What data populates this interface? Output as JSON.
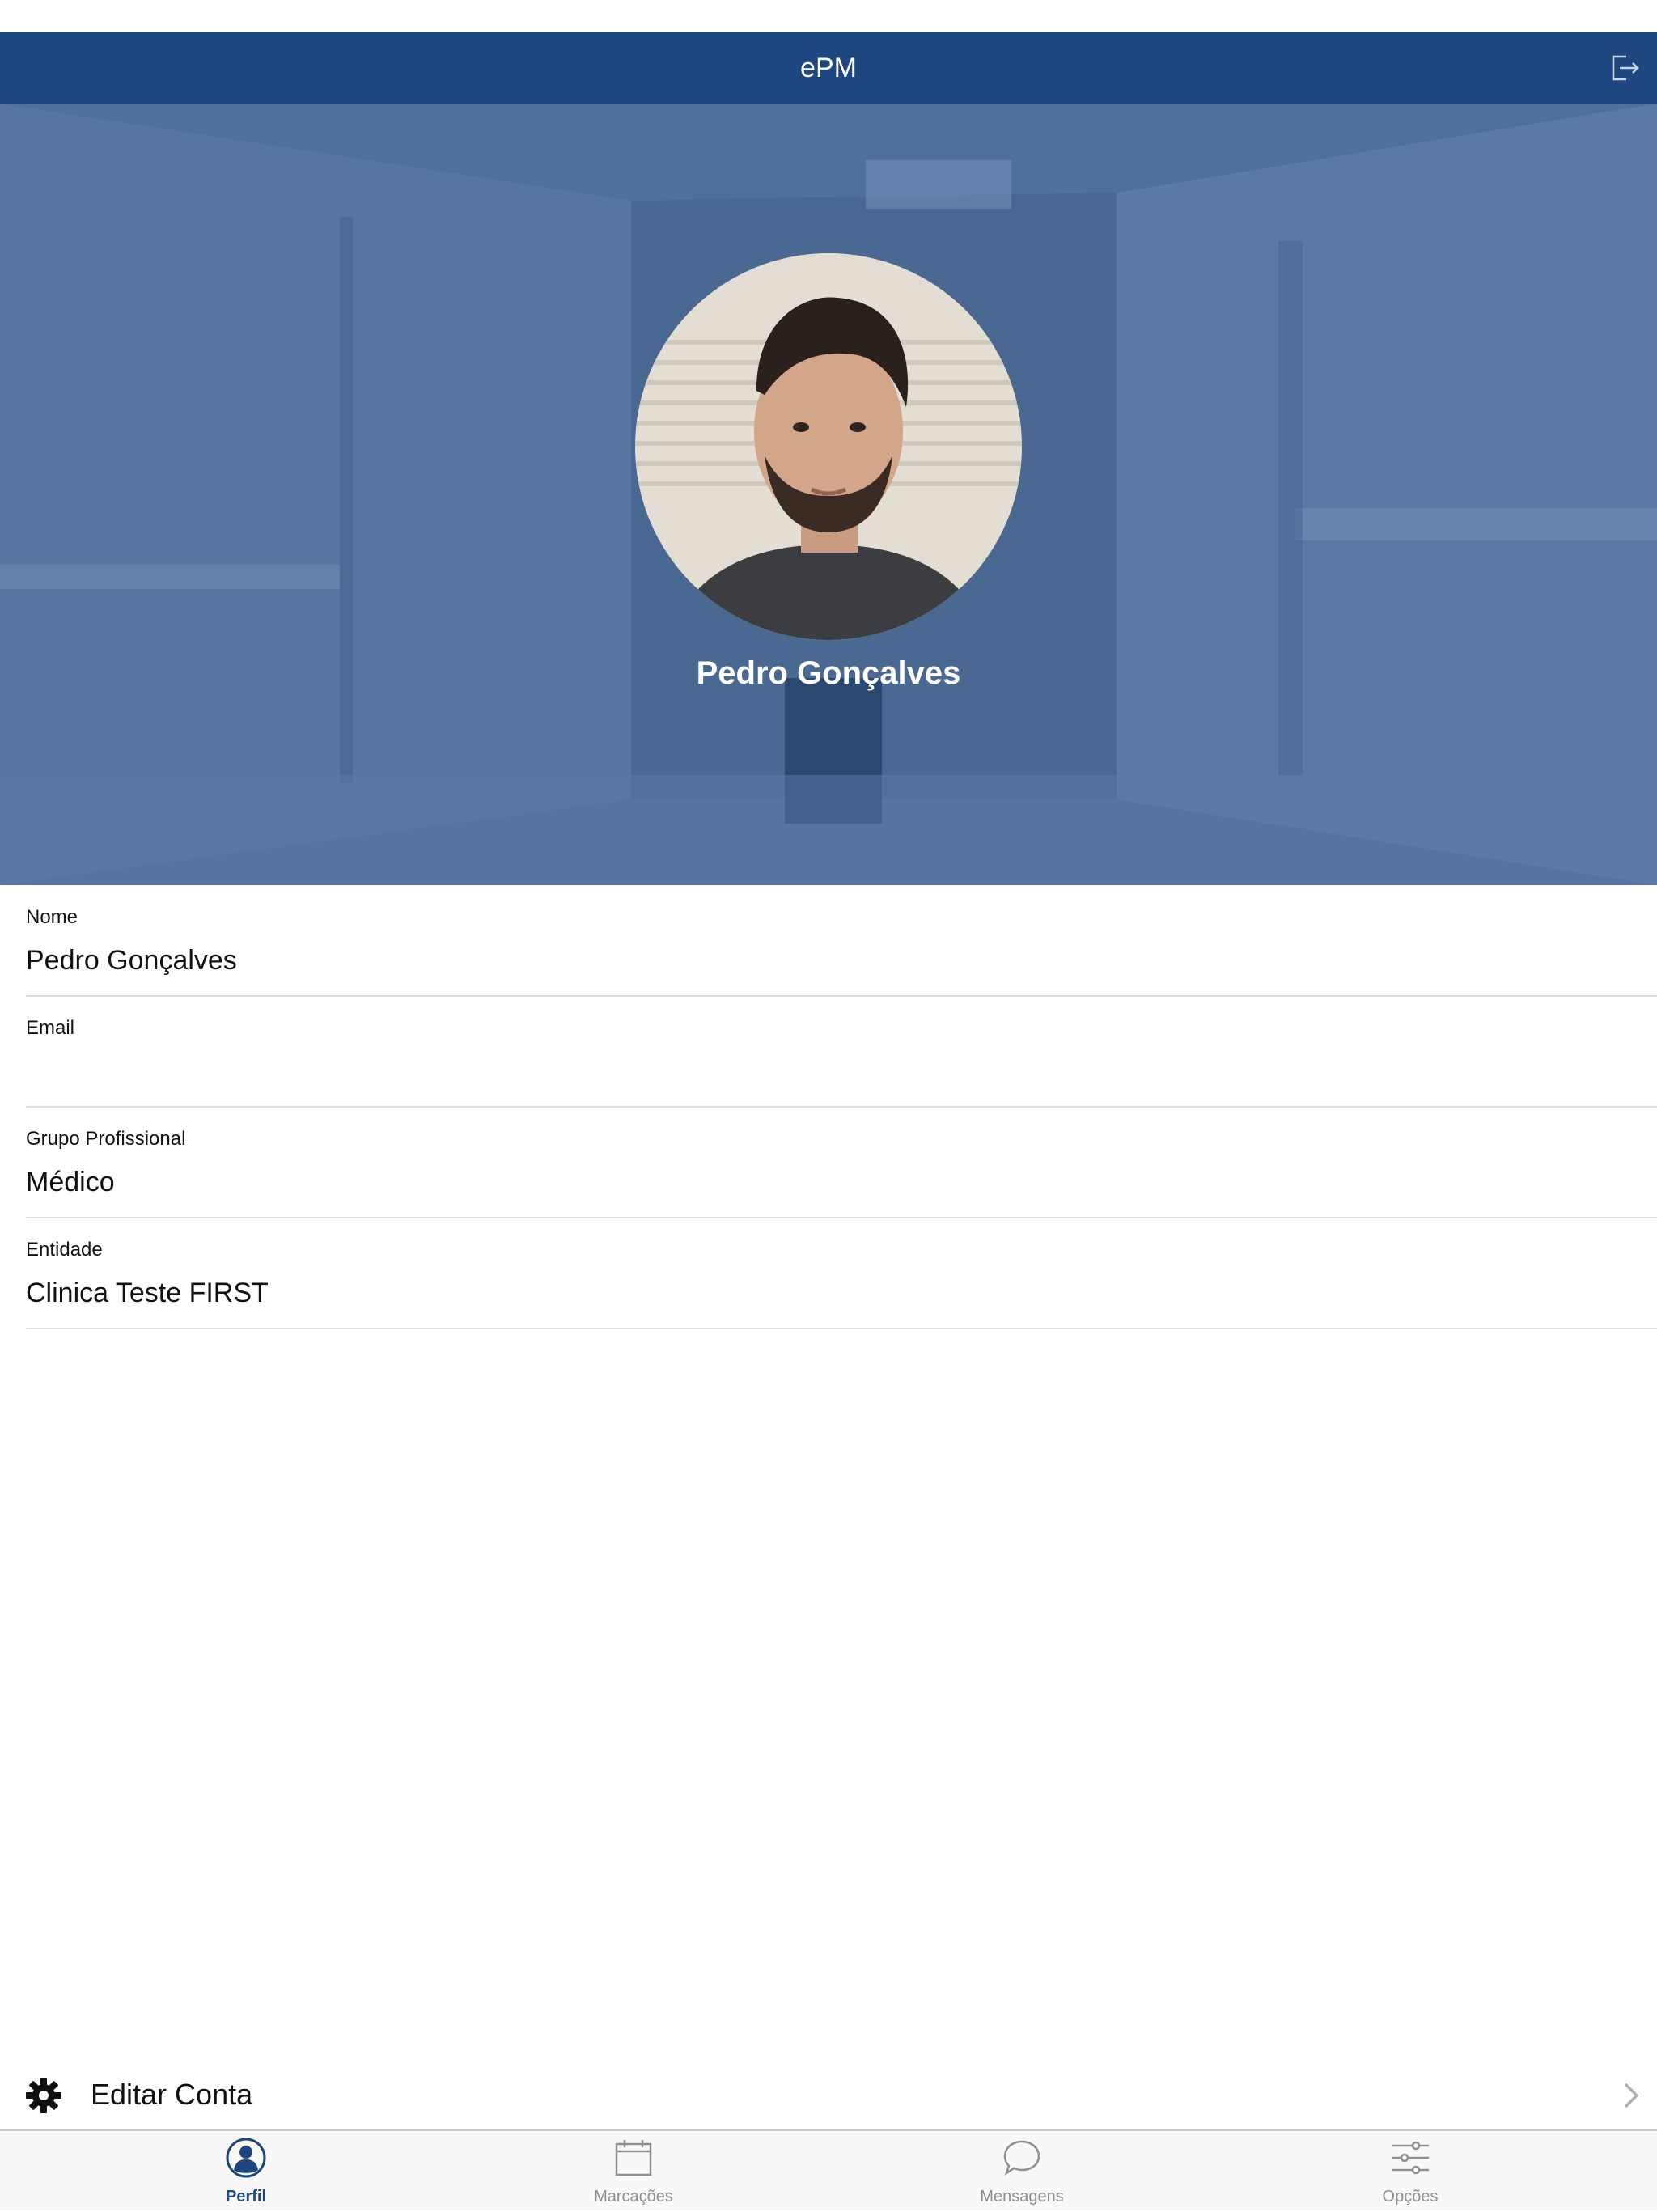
{
  "app": {
    "title": "ePM"
  },
  "header": {
    "logout_icon": "logout-icon"
  },
  "profile": {
    "name": "Pedro Gonçalves",
    "avatar_icon": "profile-photo"
  },
  "fields": [
    {
      "label": "Nome",
      "value": "Pedro Gonçalves"
    },
    {
      "label": "Email",
      "value": ""
    },
    {
      "label": "Grupo Profissional",
      "value": "Médico"
    },
    {
      "label": "Entidade",
      "value": "Clinica Teste FIRST"
    }
  ],
  "actions": {
    "edit_account": "Editar Conta",
    "edit_icon": "gear-icon"
  },
  "tabs": [
    {
      "label": "Perfil",
      "icon": "profile-icon",
      "active": true
    },
    {
      "label": "Marcações",
      "icon": "calendar-icon",
      "active": false
    },
    {
      "label": "Mensagens",
      "icon": "chat-icon",
      "active": false
    },
    {
      "label": "Opções",
      "icon": "sliders-icon",
      "active": false
    }
  ],
  "colors": {
    "nav": "#1d477e",
    "hero": "#4f6f9c",
    "tab_active": "#1d477e",
    "tab_inactive": "#8e8e93"
  }
}
